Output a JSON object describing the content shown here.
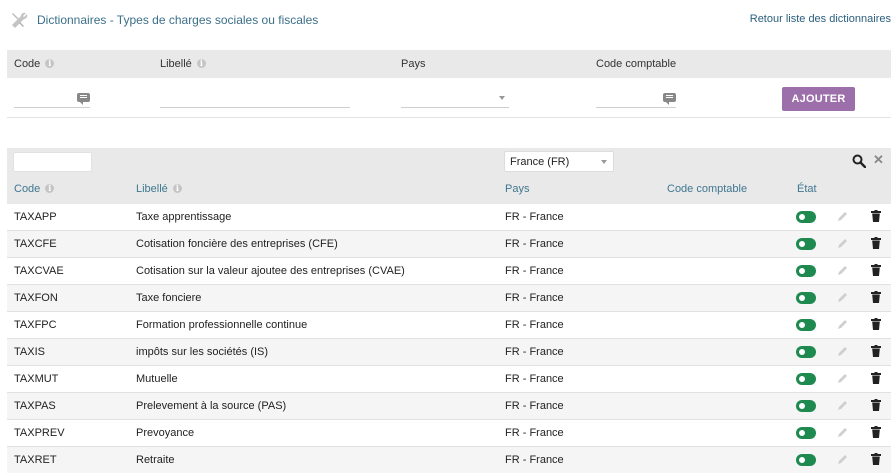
{
  "header": {
    "title": "Dictionnaires - Types de charges sociales ou fiscales",
    "back_link": "Retour liste des dictionnaires"
  },
  "form": {
    "labels": {
      "code": "Code",
      "libelle": "Libellé",
      "pays": "Pays",
      "code_comptable": "Code comptable"
    },
    "values": {
      "code": "",
      "libelle": "",
      "pays": "",
      "code_comptable": ""
    },
    "add_button": "AJOUTER"
  },
  "filter": {
    "search_value": "",
    "country_selected": "France (FR)"
  },
  "table": {
    "columns": {
      "code": "Code",
      "libelle": "Libellé",
      "pays": "Pays",
      "code_comptable": "Code comptable",
      "etat": "État"
    },
    "rows": [
      {
        "code": "TAXAPP",
        "libelle": "Taxe apprentissage",
        "pays": "FR - France",
        "code_comptable": "",
        "active": true
      },
      {
        "code": "TAXCFE",
        "libelle": "Cotisation foncière des entreprises (CFE)",
        "pays": "FR - France",
        "code_comptable": "",
        "active": true
      },
      {
        "code": "TAXCVAE",
        "libelle": "Cotisation sur la valeur ajoutee des entreprises (CVAE)",
        "pays": "FR - France",
        "code_comptable": "",
        "active": true
      },
      {
        "code": "TAXFON",
        "libelle": "Taxe fonciere",
        "pays": "FR - France",
        "code_comptable": "",
        "active": true
      },
      {
        "code": "TAXFPC",
        "libelle": "Formation professionnelle continue",
        "pays": "FR - France",
        "code_comptable": "",
        "active": true
      },
      {
        "code": "TAXIS",
        "libelle": "impôts sur les sociétés (IS)",
        "pays": "FR - France",
        "code_comptable": "",
        "active": true
      },
      {
        "code": "TAXMUT",
        "libelle": "Mutuelle",
        "pays": "FR - France",
        "code_comptable": "",
        "active": true
      },
      {
        "code": "TAXPAS",
        "libelle": "Prelevement à la source (PAS)",
        "pays": "FR - France",
        "code_comptable": "",
        "active": true
      },
      {
        "code": "TAXPREV",
        "libelle": "Prevoyance",
        "pays": "FR - France",
        "code_comptable": "",
        "active": true
      },
      {
        "code": "TAXRET",
        "libelle": "Retraite",
        "pays": "FR - France",
        "code_comptable": "",
        "active": true
      }
    ]
  },
  "icons": {
    "header": "tools-icon",
    "info": "info-icon",
    "comment": "comment-icon",
    "search": "search-icon",
    "clear": "close-icon",
    "edit": "pencil-icon",
    "delete": "trash-icon",
    "toggle": "toggle-switch"
  },
  "colors": {
    "title": "#3b6f89",
    "accent_button": "#9c6faa",
    "toggle_on": "#1e8a4f",
    "header_bg": "#e9e9e9"
  }
}
